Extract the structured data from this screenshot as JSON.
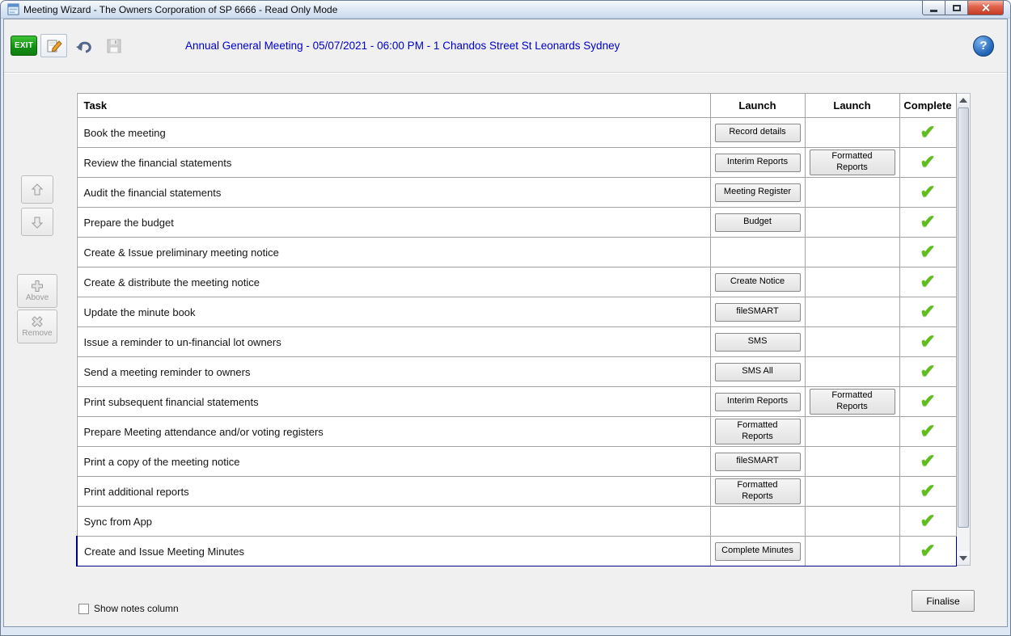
{
  "window": {
    "title": "Meeting Wizard - The Owners Corporation of SP 6666 - Read Only Mode"
  },
  "toolbar": {
    "exit_label": "EXIT",
    "meeting_header": "Annual General Meeting - 05/07/2021 - 06:00 PM - 1 Chandos Street St Leonards Sydney",
    "help_label": "?"
  },
  "side_panel": {
    "above_label": "Above",
    "remove_label": "Remove"
  },
  "table": {
    "headers": {
      "task": "Task",
      "launch1": "Launch",
      "launch2": "Launch",
      "complete": "Complete"
    },
    "rows": [
      {
        "task": "Book the meeting",
        "launch1": "Record details",
        "launch2": "",
        "complete": true,
        "selected": false
      },
      {
        "task": "Review the financial statements",
        "launch1": "Interim Reports",
        "launch2": "Formatted\nReports",
        "complete": true,
        "selected": false
      },
      {
        "task": "Audit the financial statements",
        "launch1": "Meeting Register",
        "launch2": "",
        "complete": true,
        "selected": false
      },
      {
        "task": "Prepare the budget",
        "launch1": "Budget",
        "launch2": "",
        "complete": true,
        "selected": false
      },
      {
        "task": "Create & Issue preliminary meeting notice",
        "launch1": "",
        "launch2": "",
        "complete": true,
        "selected": false
      },
      {
        "task": "Create & distribute the meeting notice",
        "launch1": "Create Notice",
        "launch2": "",
        "complete": true,
        "selected": false
      },
      {
        "task": "Update the minute book",
        "launch1": "fileSMART",
        "launch2": "",
        "complete": true,
        "selected": false
      },
      {
        "task": "Issue a reminder to un-financial lot owners",
        "launch1": "SMS",
        "launch2": "",
        "complete": true,
        "selected": false
      },
      {
        "task": "Send a meeting reminder to owners",
        "launch1": "SMS All",
        "launch2": "",
        "complete": true,
        "selected": false
      },
      {
        "task": "Print subsequent financial statements",
        "launch1": "Interim Reports",
        "launch2": "Formatted\nReports",
        "complete": true,
        "selected": false
      },
      {
        "task": "Prepare Meeting attendance and/or voting registers",
        "launch1": "Formatted\nReports",
        "launch2": "",
        "complete": true,
        "selected": false
      },
      {
        "task": "Print a copy of the meeting notice",
        "launch1": "fileSMART",
        "launch2": "",
        "complete": true,
        "selected": false
      },
      {
        "task": "Print additional reports",
        "launch1": "Formatted\nReports",
        "launch2": "",
        "complete": true,
        "selected": false
      },
      {
        "task": "Sync from App",
        "launch1": "",
        "launch2": "",
        "complete": true,
        "selected": false
      },
      {
        "task": "Create and Issue Meeting Minutes",
        "launch1": "Complete Minutes",
        "launch2": "",
        "complete": true,
        "selected": true
      }
    ]
  },
  "footer": {
    "show_notes_label": "Show notes column",
    "show_notes_checked": false,
    "finalise_label": "Finalise"
  },
  "colors": {
    "check_green": "#5fbe1e",
    "meeting_header_blue": "#0000cc",
    "exit_green": "#149114",
    "selection_navy": "#000090"
  }
}
